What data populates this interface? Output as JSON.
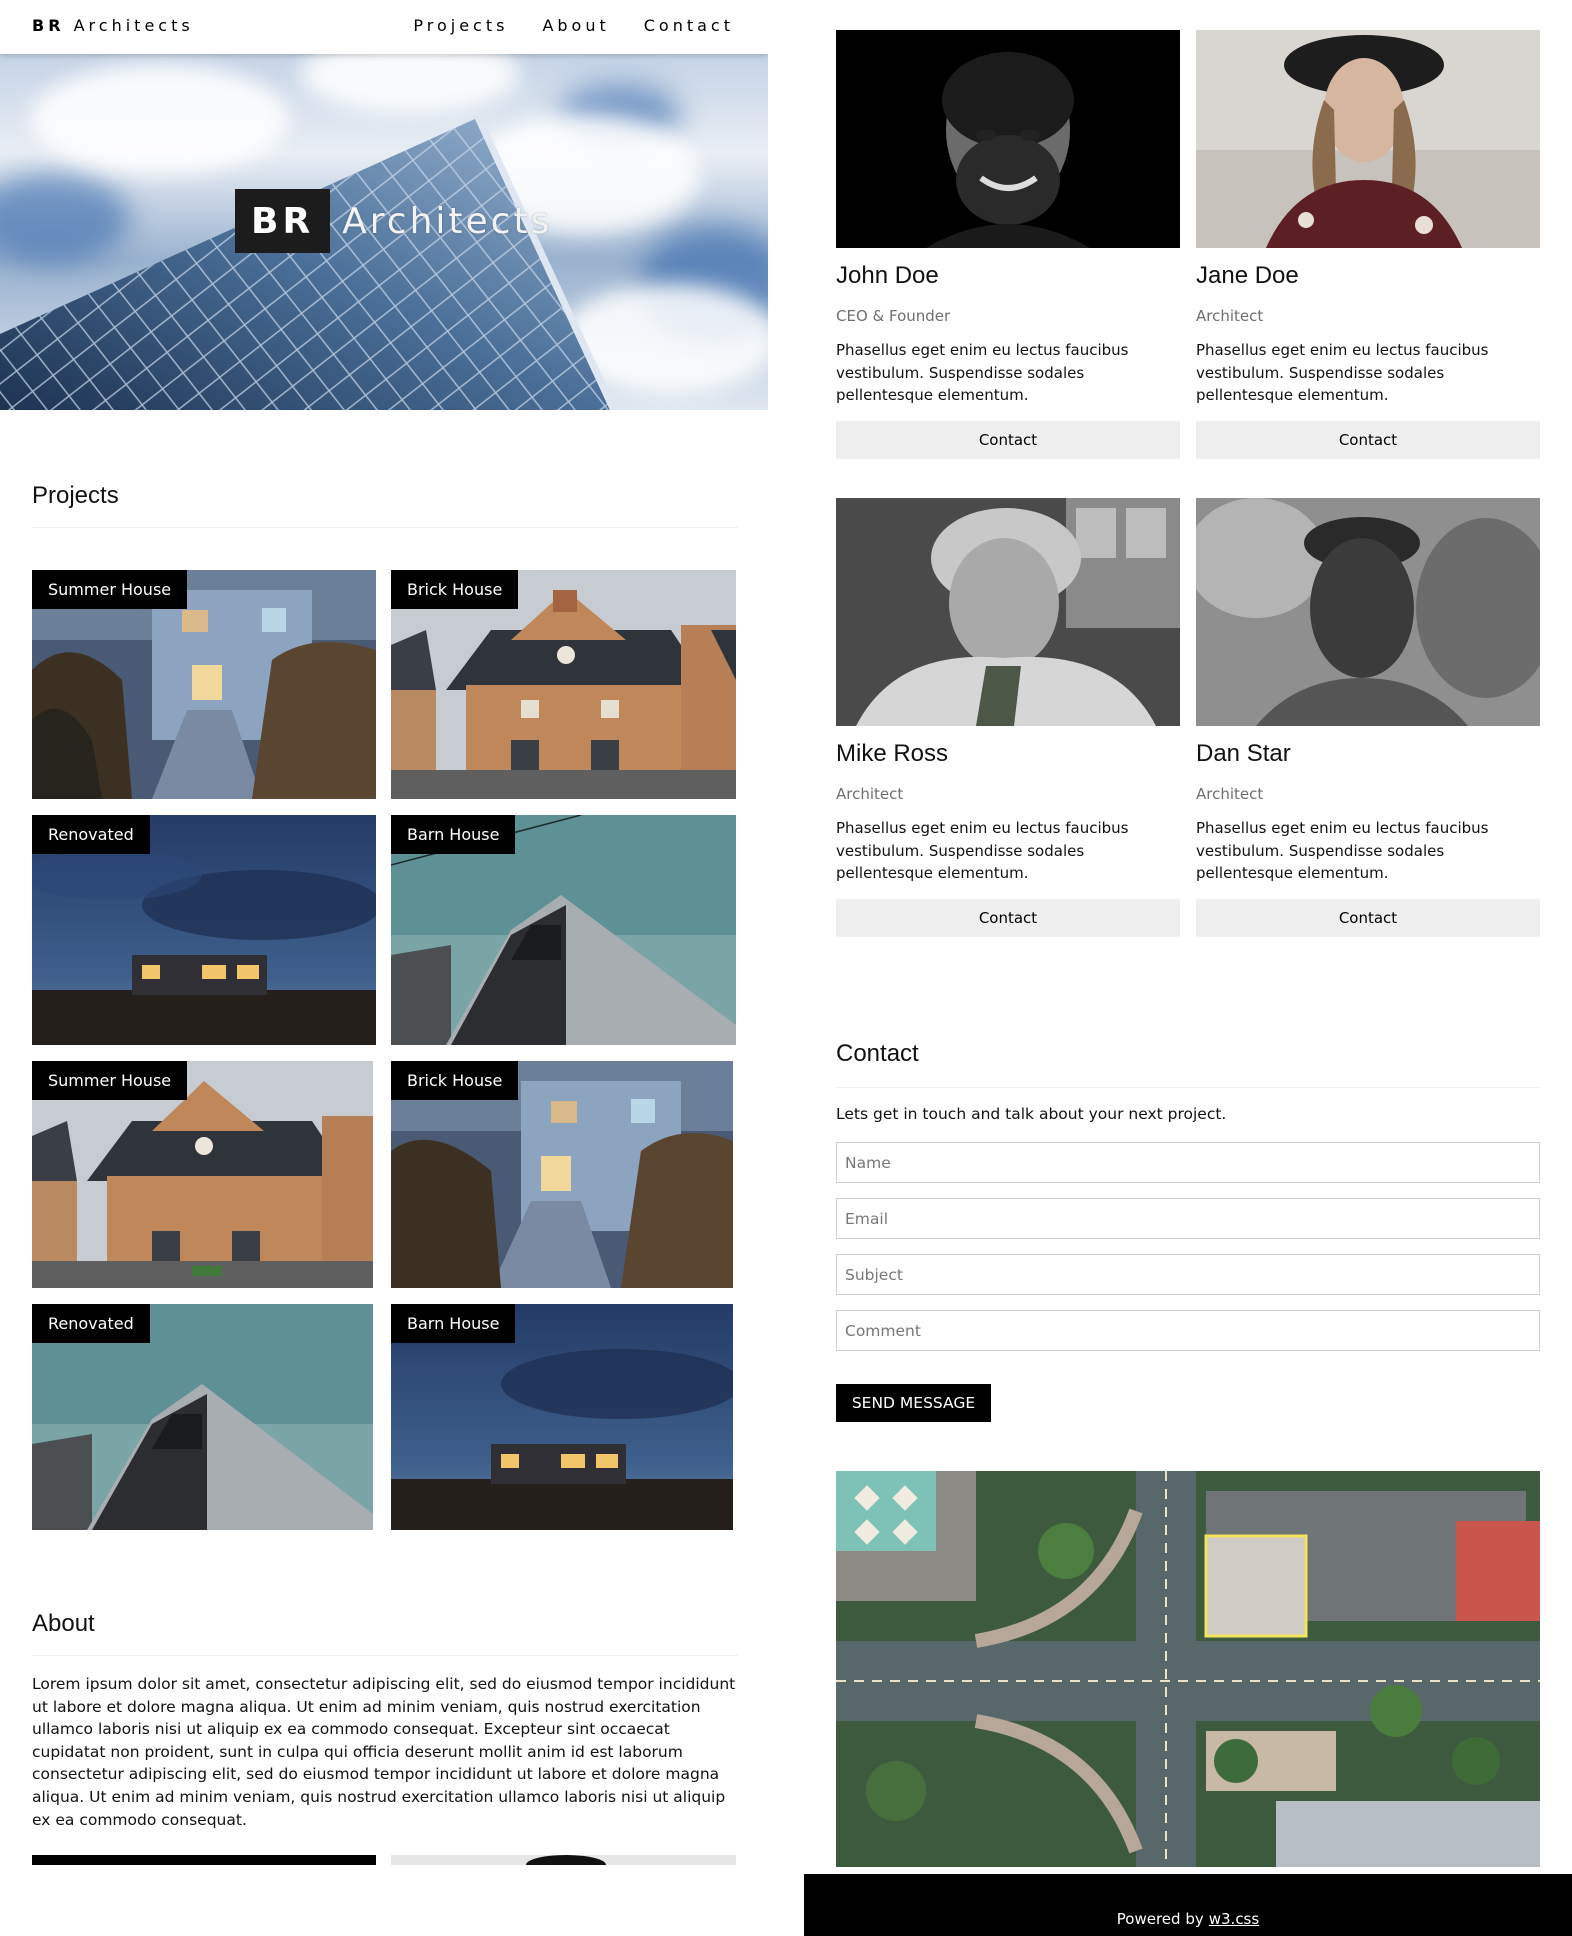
{
  "nav": {
    "brand_bold": "BR",
    "brand_rest": "Architects",
    "links": [
      "Projects",
      "About",
      "Contact"
    ]
  },
  "hero": {
    "title_bold": "BR",
    "title_rest": "Architects"
  },
  "projects": {
    "heading": "Projects",
    "items": [
      {
        "label": "Summer House"
      },
      {
        "label": "Brick House"
      },
      {
        "label": "Renovated"
      },
      {
        "label": "Barn House"
      },
      {
        "label": "Summer House"
      },
      {
        "label": "Brick House"
      },
      {
        "label": "Renovated"
      },
      {
        "label": "Barn House"
      }
    ]
  },
  "about": {
    "heading": "About",
    "text": "Lorem ipsum dolor sit amet, consectetur adipiscing elit, sed do eiusmod tempor incididunt ut labore et dolore magna aliqua. Ut enim ad minim veniam, quis nostrud exercitation ullamco laboris nisi ut aliquip ex ea commodo consequat. Excepteur sint occaecat cupidatat non proident, sunt in culpa qui officia deserunt mollit anim id est laborum consectetur adipiscing elit, sed do eiusmod tempor incididunt ut labore et dolore magna aliqua. Ut enim ad minim veniam, quis nostrud exercitation ullamco laboris nisi ut aliquip ex ea commodo consequat."
  },
  "team": [
    {
      "name": "John Doe",
      "role": "CEO & Founder",
      "desc": "Phasellus eget enim eu lectus faucibus vestibulum. Suspendisse sodales pellentesque elementum.",
      "button": "Contact"
    },
    {
      "name": "Jane Doe",
      "role": "Architect",
      "desc": "Phasellus eget enim eu lectus faucibus vestibulum. Suspendisse sodales pellentesque elementum.",
      "button": "Contact"
    },
    {
      "name": "Mike Ross",
      "role": "Architect",
      "desc": "Phasellus eget enim eu lectus faucibus vestibulum. Suspendisse sodales pellentesque elementum.",
      "button": "Contact"
    },
    {
      "name": "Dan Star",
      "role": "Architect",
      "desc": "Phasellus eget enim eu lectus faucibus vestibulum. Suspendisse sodales pellentesque elementum.",
      "button": "Contact"
    }
  ],
  "contact": {
    "heading": "Contact",
    "lead": "Lets get in touch and talk about your next project.",
    "fields": {
      "name": "Name",
      "email": "Email",
      "subject": "Subject",
      "comment": "Comment"
    },
    "send": "SEND MESSAGE"
  },
  "footer": {
    "prefix": "Powered by",
    "link": "w3.css"
  },
  "colors": {
    "label_bg": "#000000",
    "button_bg": "#efefef",
    "send_bg": "#000000",
    "footer_bg": "#000000"
  }
}
